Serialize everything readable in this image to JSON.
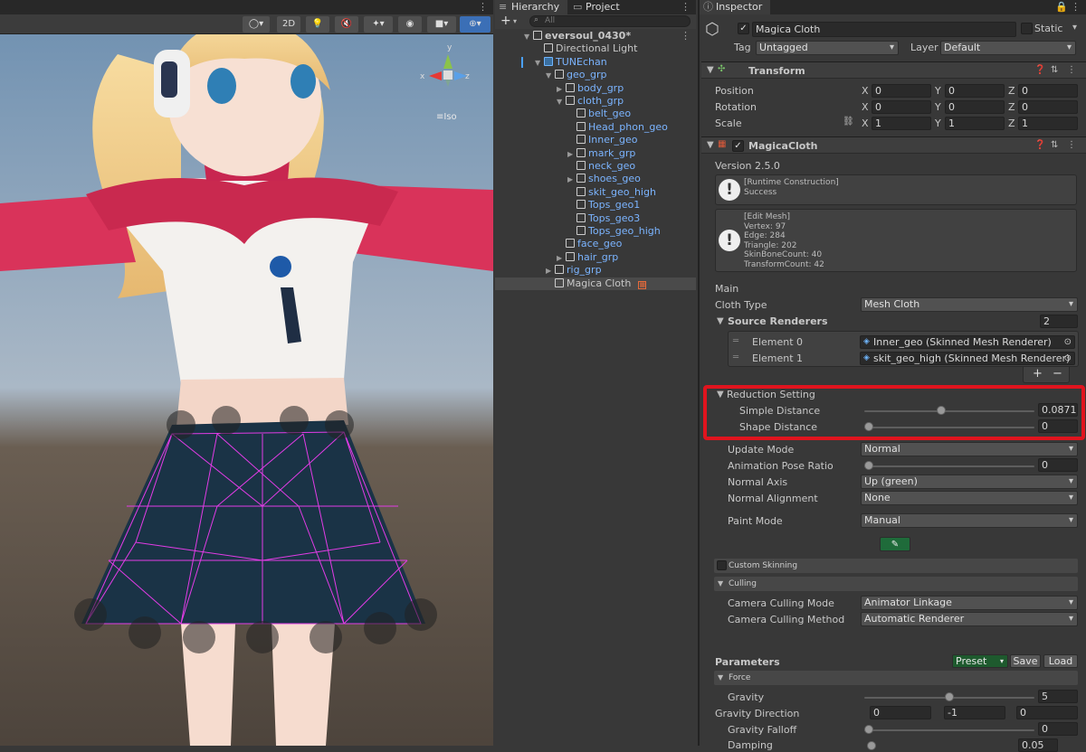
{
  "scene": {
    "toolbar": {
      "mode_2d": "2D"
    },
    "gizmo": {
      "persp_label": "Iso",
      "axis_x": "x",
      "axis_y": "y",
      "axis_z": "z"
    }
  },
  "hierarchy": {
    "tab_hierarchy": "Hierarchy",
    "tab_project": "Project",
    "add_label": "+",
    "search_placeholder": "All",
    "rows": [
      {
        "label": "eversoul_0430*",
        "indent": 0,
        "type": "scene",
        "expanded": true,
        "selected": false,
        "blue": false,
        "bold": true
      },
      {
        "label": "Directional Light",
        "indent": 1,
        "type": "object",
        "expanded": null,
        "selected": false,
        "blue": false
      },
      {
        "label": "TUNEchan",
        "indent": 1,
        "type": "prefab",
        "expanded": true,
        "selected": false,
        "blue": true
      },
      {
        "label": "geo_grp",
        "indent": 2,
        "type": "object",
        "expanded": true,
        "selected": false,
        "blue": true
      },
      {
        "label": "body_grp",
        "indent": 3,
        "type": "object",
        "expanded": false,
        "selected": false,
        "blue": true
      },
      {
        "label": "cloth_grp",
        "indent": 3,
        "type": "object",
        "expanded": true,
        "selected": false,
        "blue": true
      },
      {
        "label": "belt_geo",
        "indent": 4,
        "type": "object",
        "expanded": null,
        "selected": false,
        "blue": true
      },
      {
        "label": "Head_phon_geo",
        "indent": 4,
        "type": "object",
        "expanded": null,
        "selected": false,
        "blue": true
      },
      {
        "label": "Inner_geo",
        "indent": 4,
        "type": "object",
        "expanded": null,
        "selected": false,
        "blue": true
      },
      {
        "label": "mark_grp",
        "indent": 4,
        "type": "object",
        "expanded": false,
        "selected": false,
        "blue": true
      },
      {
        "label": "neck_geo",
        "indent": 4,
        "type": "object",
        "expanded": null,
        "selected": false,
        "blue": true
      },
      {
        "label": "shoes_geo",
        "indent": 4,
        "type": "object",
        "expanded": false,
        "selected": false,
        "blue": true
      },
      {
        "label": "skit_geo_high",
        "indent": 4,
        "type": "object",
        "expanded": null,
        "selected": false,
        "blue": true
      },
      {
        "label": "Tops_geo1",
        "indent": 4,
        "type": "object",
        "expanded": null,
        "selected": false,
        "blue": true
      },
      {
        "label": "Tops_geo3",
        "indent": 4,
        "type": "object",
        "expanded": null,
        "selected": false,
        "blue": true
      },
      {
        "label": "Tops_geo_high",
        "indent": 4,
        "type": "object",
        "expanded": null,
        "selected": false,
        "blue": true
      },
      {
        "label": "face_geo",
        "indent": 3,
        "type": "object",
        "expanded": null,
        "selected": false,
        "blue": true
      },
      {
        "label": "hair_grp",
        "indent": 3,
        "type": "object",
        "expanded": false,
        "selected": false,
        "blue": true
      },
      {
        "label": "rig_grp",
        "indent": 2,
        "type": "object",
        "expanded": false,
        "selected": false,
        "blue": true
      },
      {
        "label": "Magica Cloth",
        "indent": 2,
        "type": "object",
        "expanded": null,
        "selected": true,
        "blue": false
      }
    ]
  },
  "inspector": {
    "tab": "Inspector",
    "object_name": "Magica Cloth",
    "static_label": "Static",
    "tag_label": "Tag",
    "tag_value": "Untagged",
    "layer_label": "Layer",
    "layer_value": "Default",
    "transform": {
      "title": "Transform",
      "rows": [
        {
          "label": "Position",
          "x": "0",
          "y": "0",
          "z": "0"
        },
        {
          "label": "Rotation",
          "x": "0",
          "y": "0",
          "z": "0"
        },
        {
          "label": "Scale",
          "x": "1",
          "y": "1",
          "z": "1"
        }
      ],
      "axis_x": "X",
      "axis_y": "Y",
      "axis_z": "Z"
    },
    "magica": {
      "title": "MagicaCloth",
      "version": "Version 2.5.0",
      "help1": "[Runtime Construction]\nSuccess",
      "help2": "[Edit Mesh]\nVertex: 97\nEdge: 284\nTriangle: 202\nSkinBoneCount: 40\nTransformCount: 42",
      "main_header": "Main",
      "cloth_type_label": "Cloth Type",
      "cloth_type_value": "Mesh Cloth",
      "source_renderers_label": "Source Renderers",
      "source_renderers_count": "2",
      "elements": [
        {
          "label": "Element 0",
          "value": "Inner_geo (Skinned Mesh Renderer)"
        },
        {
          "label": "Element 1",
          "value": "skit_geo_high (Skinned Mesh Renderer)"
        }
      ],
      "add_btn": "+",
      "remove_btn": "−",
      "reduction_label": "Reduction Setting",
      "simple_distance_label": "Simple Distance",
      "simple_distance_value": "0.0871",
      "simple_distance_fraction": 0.45,
      "shape_distance_label": "Shape Distance",
      "shape_distance_value": "0",
      "shape_distance_fraction": 0.0,
      "update_mode_label": "Update Mode",
      "update_mode_value": "Normal",
      "anim_pose_label": "Animation Pose Ratio",
      "anim_pose_value": "0",
      "anim_pose_fraction": 0.0,
      "normal_axis_label": "Normal Axis",
      "normal_axis_value": "Up (green)",
      "normal_align_label": "Normal Alignment",
      "normal_align_value": "None",
      "paint_mode_label": "Paint Mode",
      "paint_mode_value": "Manual",
      "custom_skinning_label": "Custom Skinning",
      "culling_label": "Culling",
      "cam_cull_mode_label": "Camera Culling Mode",
      "cam_cull_mode_value": "Animator Linkage",
      "cam_cull_method_label": "Camera Culling Method",
      "cam_cull_method_value": "Automatic Renderer",
      "parameters_label": "Parameters",
      "preset_btn": "Preset",
      "save_btn": "Save",
      "load_btn": "Load",
      "force_label": "Force",
      "gravity_label": "Gravity",
      "gravity_value": "5",
      "gravity_fraction": 0.5,
      "gravity_dir_label": "Gravity Direction",
      "gravity_dir_x": "0",
      "gravity_dir_y": "-1",
      "gravity_dir_z": "0",
      "gravity_falloff_label": "Gravity Falloff",
      "gravity_falloff_value": "0",
      "gravity_falloff_fraction": 0.0,
      "damping_label": "Damping",
      "damping_value": "0.05"
    },
    "highlight_color": "#e0141e"
  }
}
